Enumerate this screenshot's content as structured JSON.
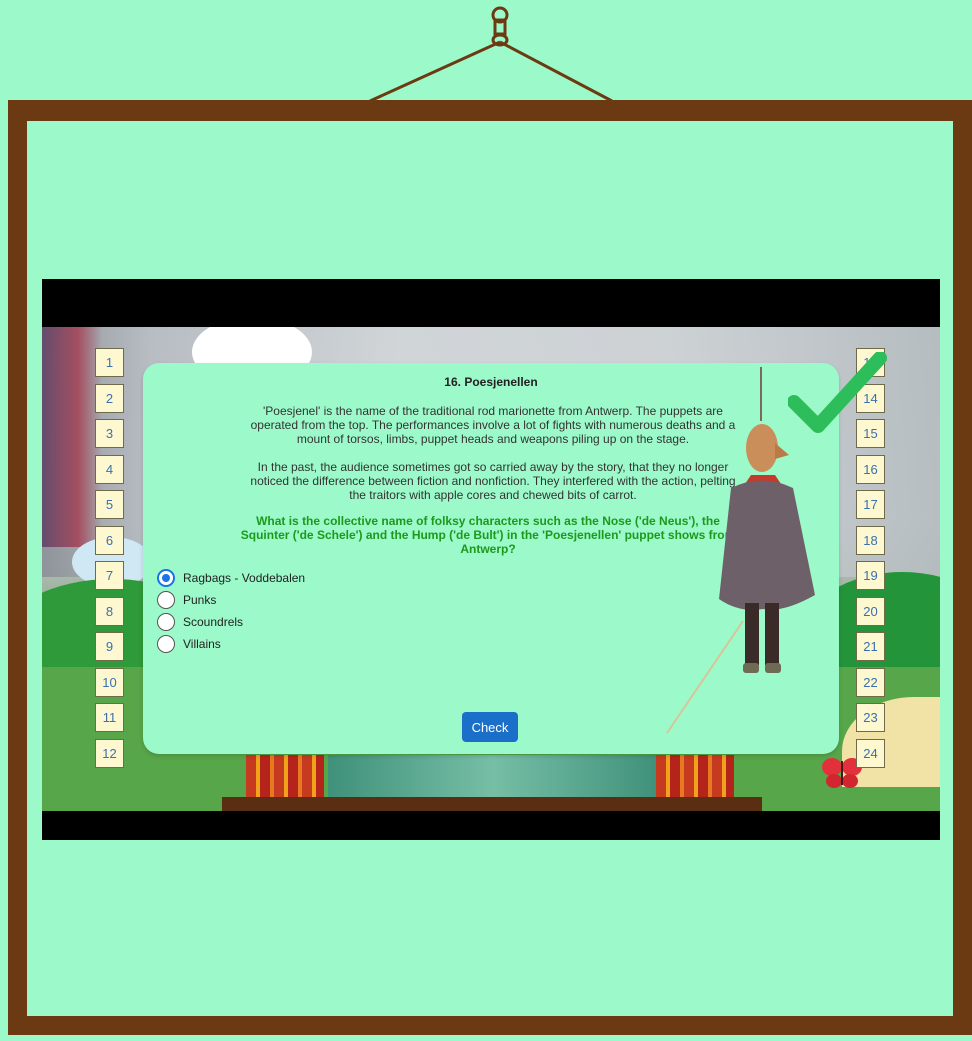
{
  "quiz": {
    "title": "16. Poesjenellen",
    "paragraph1": "'Poesjenel' is the name of the traditional rod marionette from Antwerp. The puppets are operated from the top. The performances involve a lot of fights with numerous deaths and a mount of torsos, limbs, puppet heads and weapons piling up on the stage.",
    "paragraph2": "In the past, the audience sometimes got so carried away by the story, that they no longer noticed the difference between fiction and nonfiction. They interfered with the action, pelting the traitors with apple cores and chewed bits of carrot.",
    "question": "What is the collective name of folksy characters such as the Nose ('de Neus'), the Squinter ('de Schele') and the Hump ('de Bult') in the 'Poesjenellen' puppet shows from Antwerp?",
    "options": [
      {
        "label": "Ragbags - Voddebalen",
        "selected": true
      },
      {
        "label": "Punks",
        "selected": false
      },
      {
        "label": "Scoundrels",
        "selected": false
      },
      {
        "label": "Villains",
        "selected": false
      }
    ],
    "check_label": "Check"
  },
  "left_numbers": [
    "1",
    "2",
    "3",
    "4",
    "5",
    "6",
    "7",
    "8",
    "9",
    "10",
    "11",
    "12"
  ],
  "right_numbers": [
    "13",
    "14",
    "15",
    "16",
    "17",
    "18",
    "19",
    "20",
    "21",
    "22",
    "23",
    "24"
  ],
  "colors": {
    "background": "#9cf9c9",
    "frame": "#6b3a12",
    "question_text": "#1b9a1b",
    "check_button": "#1a6fc9",
    "checkmark": "#2dbd5a"
  }
}
